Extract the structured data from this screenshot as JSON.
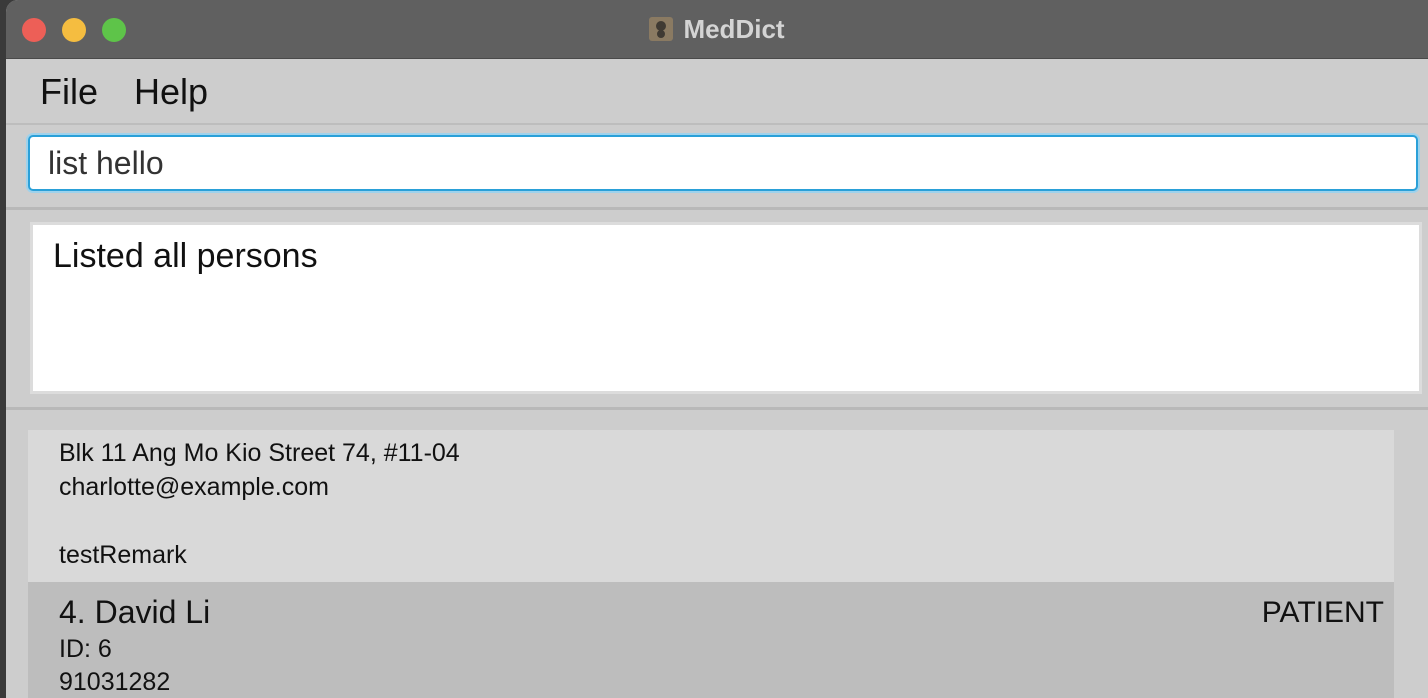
{
  "window": {
    "title": "MedDict"
  },
  "menu": {
    "file": "File",
    "help": "Help"
  },
  "command": {
    "value": "list hello"
  },
  "result": {
    "text": "Listed all persons"
  },
  "persons": [
    {
      "address": "Blk 11 Ang Mo Kio Street 74, #11-04",
      "email": "charlotte@example.com",
      "remark": "testRemark"
    },
    {
      "name": "4. David Li",
      "role": "PATIENT",
      "id": "ID: 6",
      "phone": "91031282"
    }
  ]
}
